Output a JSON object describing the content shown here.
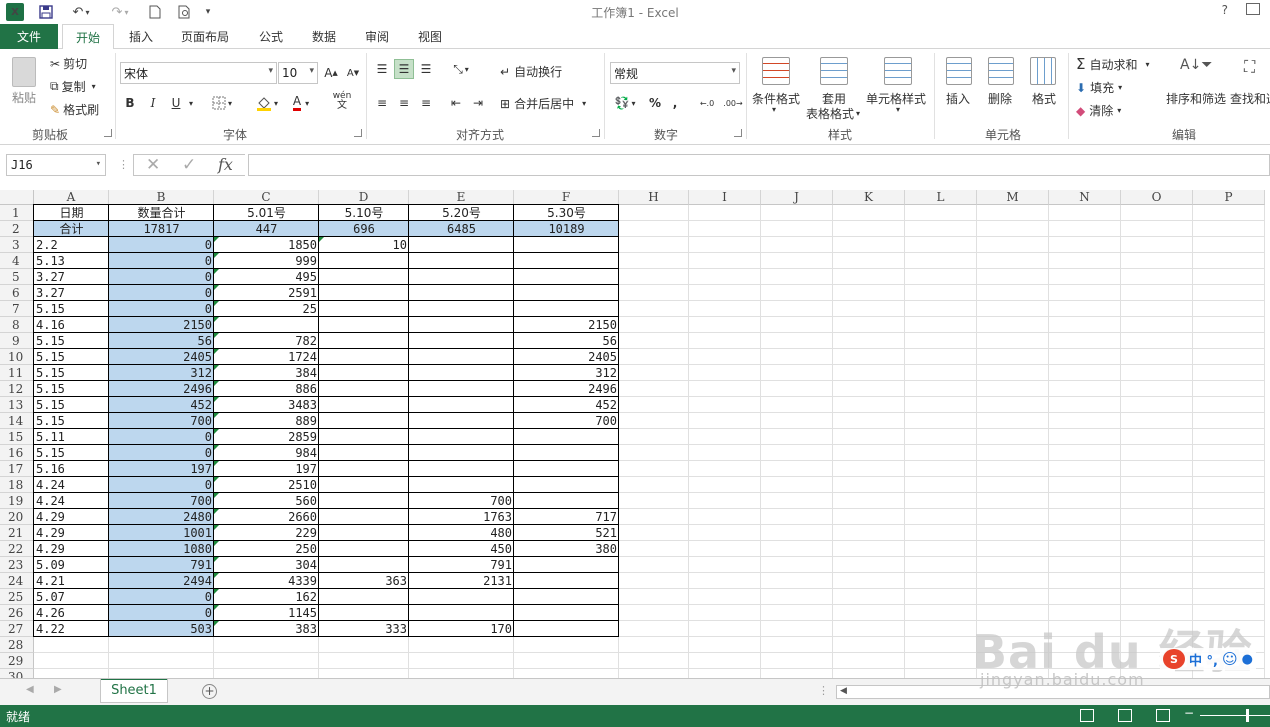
{
  "title": "工作簿1 - Excel",
  "quick_access": {
    "help": "?"
  },
  "tabs": {
    "file": "文件",
    "items": [
      "开始",
      "插入",
      "页面布局",
      "公式",
      "数据",
      "审阅",
      "视图"
    ]
  },
  "ribbon": {
    "clipboard": {
      "paste": "粘贴",
      "cut": "剪切",
      "copy": "复制",
      "format_painter": "格式刷",
      "label": "剪贴板"
    },
    "font": {
      "name": "宋体",
      "size": "10",
      "bold": "B",
      "italic": "I",
      "underline": "U",
      "wen": "wén",
      "label": "字体"
    },
    "alignment": {
      "wrap": "自动换行",
      "merge": "合并后居中",
      "label": "对齐方式"
    },
    "number": {
      "format": "常规",
      "percent": "%",
      "comma": ",",
      "label": "数字"
    },
    "styles": {
      "conditional": "条件格式",
      "table_format_1": "套用",
      "table_format_2": "表格格式",
      "cell_styles": "单元格样式",
      "label": "样式"
    },
    "cells": {
      "insert": "插入",
      "delete": "删除",
      "format": "格式",
      "label": "单元格"
    },
    "editing": {
      "autosum": "自动求和",
      "fill": "填充",
      "clear": "清除",
      "sort": "排序和筛选",
      "find": "查找和选",
      "label": "编辑"
    }
  },
  "formula_bar": {
    "namebox": "J16",
    "fx": "fx",
    "value": ""
  },
  "columns": [
    "A",
    "B",
    "C",
    "D",
    "E",
    "F",
    "H",
    "I",
    "J",
    "K",
    "L",
    "M",
    "N",
    "O",
    "P"
  ],
  "rows": [
    "1",
    "2",
    "3",
    "4",
    "5",
    "6",
    "7",
    "8",
    "9",
    "10",
    "11",
    "12",
    "13",
    "14",
    "15",
    "16",
    "17",
    "18",
    "19",
    "20",
    "21",
    "22",
    "23",
    "24",
    "25",
    "26",
    "27",
    "28",
    "29",
    "30"
  ],
  "sheet": {
    "header": [
      "日期",
      "数量合计",
      "5.01号",
      "5.10号",
      "5.20号",
      "5.30号"
    ],
    "totals": [
      "合计",
      "17817",
      "447",
      "696",
      "6485",
      "10189"
    ],
    "data": [
      [
        "2.2",
        "0",
        "1850",
        "10",
        "",
        ""
      ],
      [
        "5.13",
        "0",
        "999",
        "",
        "",
        ""
      ],
      [
        "3.27",
        "0",
        "495",
        "",
        "",
        ""
      ],
      [
        "3.27",
        "0",
        "2591",
        "",
        "",
        ""
      ],
      [
        "5.15",
        "0",
        "25",
        "",
        "",
        ""
      ],
      [
        "4.16",
        "2150",
        "",
        "",
        "",
        "2150"
      ],
      [
        "5.15",
        "56",
        "782",
        "",
        "",
        "56"
      ],
      [
        "5.15",
        "2405",
        "1724",
        "",
        "",
        "2405"
      ],
      [
        "5.15",
        "312",
        "384",
        "",
        "",
        "312"
      ],
      [
        "5.15",
        "2496",
        "886",
        "",
        "",
        "2496"
      ],
      [
        "5.15",
        "452",
        "3483",
        "",
        "",
        "452"
      ],
      [
        "5.15",
        "700",
        "889",
        "",
        "",
        "700"
      ],
      [
        "5.11",
        "0",
        "2859",
        "",
        "",
        ""
      ],
      [
        "5.15",
        "0",
        "984",
        "",
        "",
        ""
      ],
      [
        "5.16",
        "197",
        "197",
        "",
        "",
        ""
      ],
      [
        "4.24",
        "0",
        "2510",
        "",
        "",
        ""
      ],
      [
        "4.24",
        "700",
        "560",
        "",
        "700",
        ""
      ],
      [
        "4.29",
        "2480",
        "2660",
        "",
        "1763",
        "717"
      ],
      [
        "4.29",
        "1001",
        "229",
        "",
        "480",
        "521"
      ],
      [
        "4.29",
        "1080",
        "250",
        "",
        "450",
        "380"
      ],
      [
        "5.09",
        "791",
        "304",
        "",
        "791",
        ""
      ],
      [
        "4.21",
        "2494",
        "4339",
        "363",
        "2131",
        ""
      ],
      [
        "5.07",
        "0",
        "162",
        "",
        "",
        ""
      ],
      [
        "4.26",
        "0",
        "1145",
        "",
        "",
        ""
      ],
      [
        "4.22",
        "503",
        "383",
        "333",
        "170",
        ""
      ]
    ]
  },
  "sheet_tab": "Sheet1",
  "status": "就绪",
  "watermark": {
    "main": "Bai du 经验",
    "url": "jingyan.baidu.com"
  },
  "ime": {
    "text": "中 °,",
    "logo": "S"
  },
  "colors": {
    "accent": "#217346",
    "selection": "#bdd7ee",
    "error_marker": "#1e8a3c"
  }
}
